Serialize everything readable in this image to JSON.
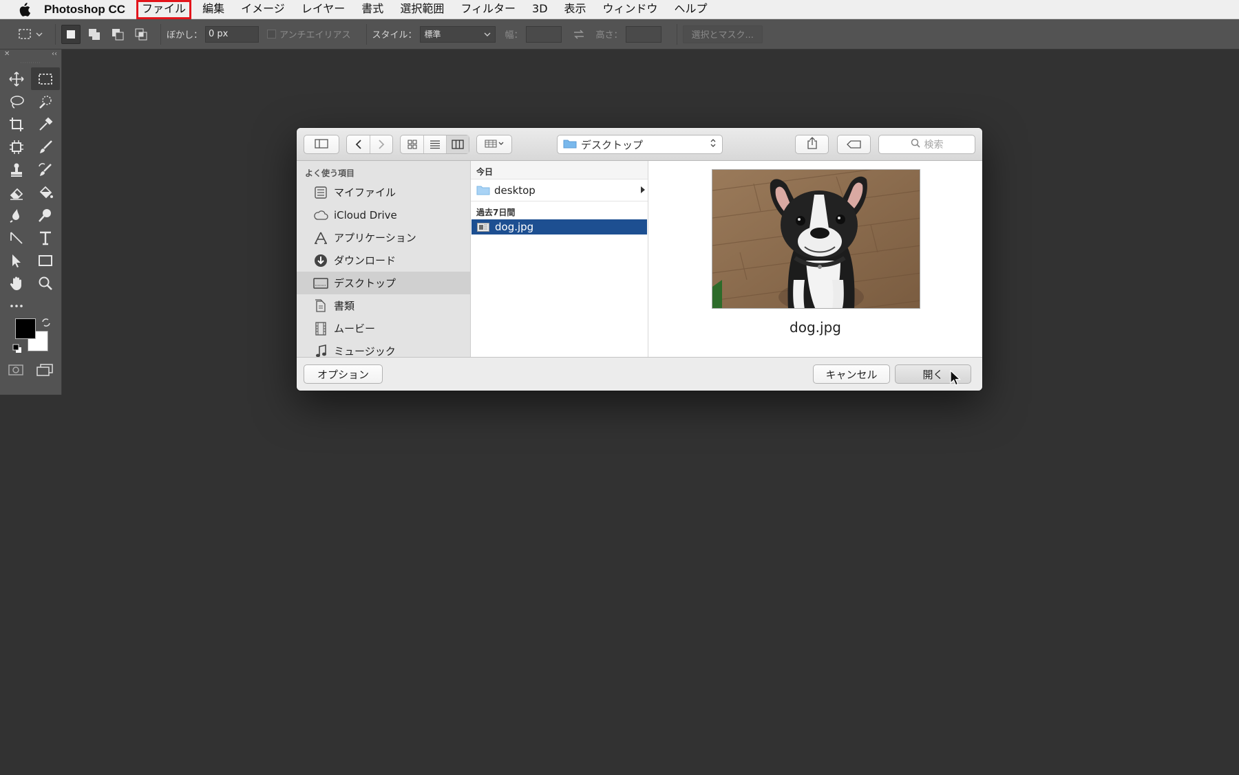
{
  "menubar": {
    "app_name": "Photoshop CC",
    "items": [
      "ファイル",
      "編集",
      "イメージ",
      "レイヤー",
      "書式",
      "選択範囲",
      "フィルター",
      "3D",
      "表示",
      "ウィンドウ",
      "ヘルプ"
    ],
    "active_index": 0,
    "highlight_color": "#e3141b"
  },
  "optionsbar": {
    "feather_label": "ぼかし：",
    "feather_value": "0 px",
    "antialias_label": "アンチエイリアス",
    "style_label": "スタイル：",
    "style_value": "標準",
    "width_label": "幅：",
    "height_label": "高さ：",
    "select_mask_label": "選択とマスク..."
  },
  "dialog": {
    "path_popup": "デスクトップ",
    "search_placeholder": "検索",
    "sidebar": {
      "header": "よく使う項目",
      "items": [
        {
          "label": "マイファイル",
          "icon": "all-my-files-icon"
        },
        {
          "label": "iCloud Drive",
          "icon": "cloud-icon"
        },
        {
          "label": "アプリケーション",
          "icon": "applications-icon"
        },
        {
          "label": "ダウンロード",
          "icon": "download-icon"
        },
        {
          "label": "デスクトップ",
          "icon": "desktop-icon"
        },
        {
          "label": "書類",
          "icon": "documents-icon"
        },
        {
          "label": "ムービー",
          "icon": "movies-icon"
        },
        {
          "label": "ミュージック",
          "icon": "music-icon"
        }
      ],
      "selected_index": 4
    },
    "column": {
      "group_today": "今日",
      "folder_name": "desktop",
      "group_week": "過去7日間",
      "file_name": "dog.jpg",
      "selection_color": "#1d4f91"
    },
    "preview": {
      "file_name": "dog.jpg"
    },
    "footer": {
      "options_label": "オプション",
      "cancel_label": "キャンセル",
      "open_label": "開く"
    }
  }
}
